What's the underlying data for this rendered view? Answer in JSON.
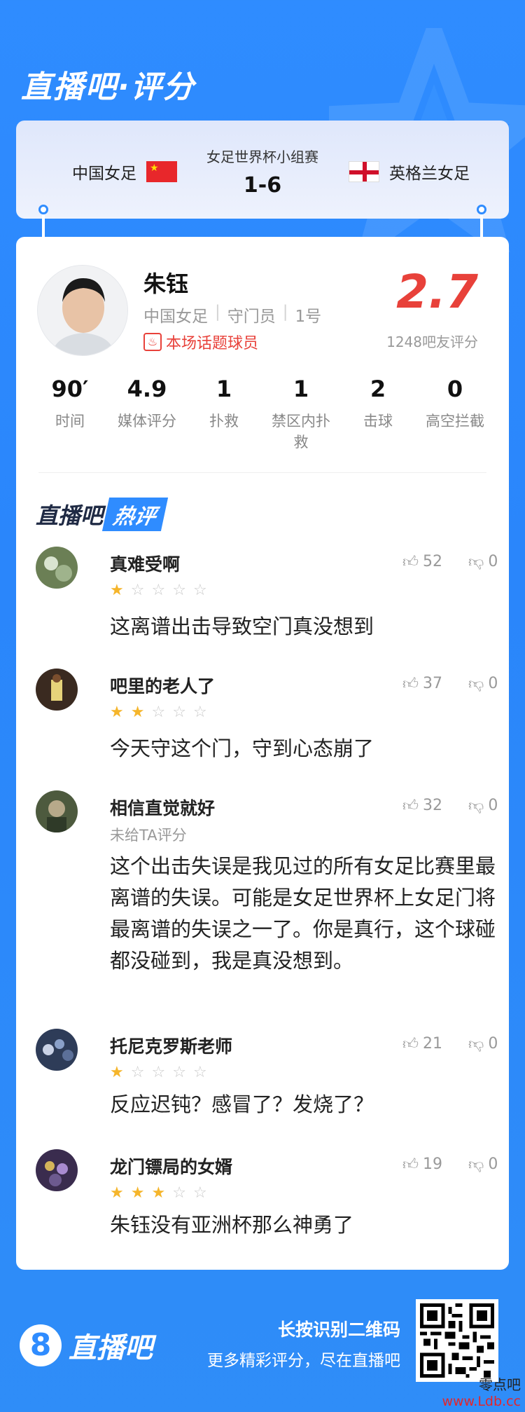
{
  "header": {
    "title": "直播吧·评分"
  },
  "match": {
    "competition": "女足世界杯小组赛",
    "score": "1-6",
    "home_team": "中国女足",
    "away_team": "英格兰女足"
  },
  "player": {
    "name": "朱钰",
    "team": "中国女足",
    "position": "守门员",
    "number": "1号",
    "badge": "本场话题球员",
    "rating": "2.7",
    "rating_caption": "1248吧友评分"
  },
  "stats": [
    {
      "value": "90′",
      "label": "时间"
    },
    {
      "value": "4.9",
      "label": "媒体评分"
    },
    {
      "value": "1",
      "label": "扑救"
    },
    {
      "value": "1",
      "label": "禁区内扑救"
    },
    {
      "value": "2",
      "label": "击球"
    },
    {
      "value": "0",
      "label": "高空拦截"
    }
  ],
  "hot_section": {
    "title_main": "直播吧",
    "title_tag": "热评"
  },
  "comments": [
    {
      "user": "真难受啊",
      "stars": 1,
      "likes": "52",
      "dislikes": "0",
      "text": "这离谱出击导致空门真没想到"
    },
    {
      "user": "吧里的老人了",
      "stars": 2,
      "likes": "37",
      "dislikes": "0",
      "text": "今天守这个门，守到心态崩了"
    },
    {
      "user": "相信直觉就好",
      "stars": 0,
      "sub": "未给TA评分",
      "likes": "32",
      "dislikes": "0",
      "text": "这个出击失误是我见过的所有女足比赛里最离谱的失误。可能是女足世界杯上女足门将最离谱的失误之一了。你是真行，这个球碰都没碰到，我是真没想到。"
    },
    {
      "user": "托尼克罗斯老师",
      "stars": 1,
      "likes": "21",
      "dislikes": "0",
      "text": "反应迟钝？感冒了？发烧了？"
    },
    {
      "user": "龙门镖局的女婿",
      "stars": 3,
      "likes": "19",
      "dislikes": "0",
      "text": "朱钰没有亚洲杯那么神勇了"
    }
  ],
  "footer": {
    "logo_number": "8",
    "logo_text": "直播吧",
    "qr_title": "长按识别二维码",
    "qr_subtitle": "更多精彩评分，尽在直播吧"
  },
  "watermark": {
    "text": "零点吧",
    "url": "www.Ldb.cc"
  },
  "colors": {
    "accent": "#2f8cff",
    "rating": "#e8413a",
    "star": "#f5b52b"
  }
}
